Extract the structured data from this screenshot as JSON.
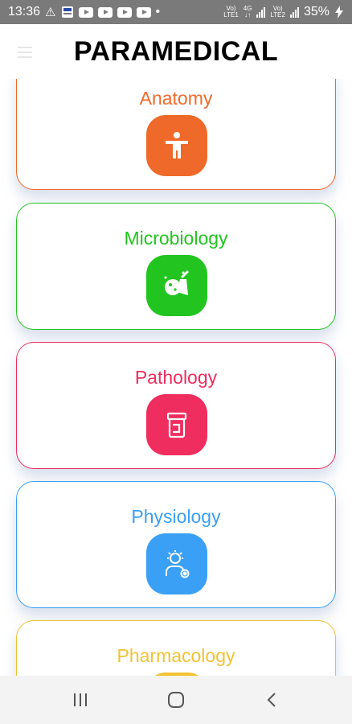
{
  "status_bar": {
    "time": "13:36",
    "battery": "35%",
    "sim1_top": "Vo)",
    "sim1_bottom": "LTE1",
    "net_top": "4G",
    "net_bottom": "↓↑",
    "sim2_top": "Vo)",
    "sim2_bottom": "LTE2"
  },
  "app_bar": {
    "title": "PARAMEDICAL"
  },
  "subjects": [
    {
      "label": "Anatomy",
      "color": "#ef6a2a",
      "icon": "body-icon"
    },
    {
      "label": "Microbiology",
      "color": "#22c51f",
      "icon": "bacteria-icon"
    },
    {
      "label": "Pathology",
      "color": "#ef2d5e",
      "icon": "specimen-jar-icon"
    },
    {
      "label": "Physiology",
      "color": "#3aa0f5",
      "icon": "person-gear-icon"
    },
    {
      "label": "Pharmacology",
      "color": "#f2c232",
      "icon": "medicine-icon"
    }
  ]
}
